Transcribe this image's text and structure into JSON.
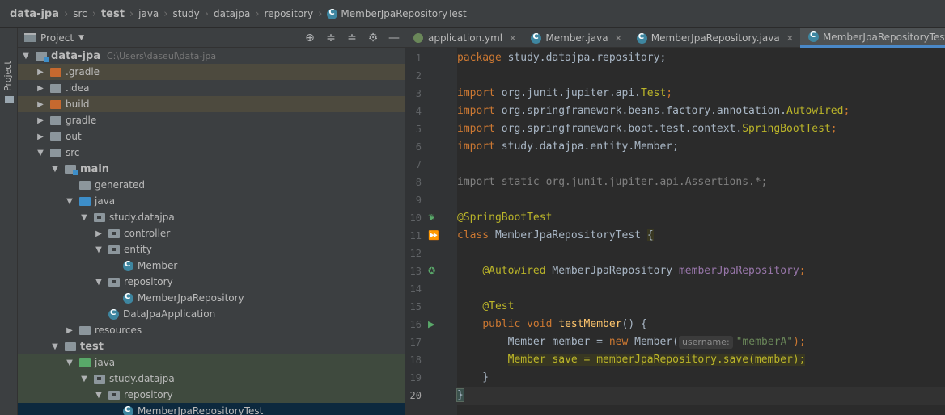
{
  "breadcrumb": [
    "data-jpa",
    "src",
    "test",
    "java",
    "study",
    "datajpa",
    "repository",
    "MemberJpaRepositoryTest"
  ],
  "strip": {
    "label": "Project"
  },
  "panel": {
    "title": "Project"
  },
  "tree": [
    {
      "label": "data-jpa",
      "path": "C:\\Users\\daseul\\data-jpa"
    },
    {
      "label": ".gradle"
    },
    {
      "label": ".idea"
    },
    {
      "label": "build"
    },
    {
      "label": "gradle"
    },
    {
      "label": "out"
    },
    {
      "label": "src"
    },
    {
      "label": "main"
    },
    {
      "label": "generated"
    },
    {
      "label": "java"
    },
    {
      "label": "study.datajpa"
    },
    {
      "label": "controller"
    },
    {
      "label": "entity"
    },
    {
      "label": "Member"
    },
    {
      "label": "repository"
    },
    {
      "label": "MemberJpaRepository"
    },
    {
      "label": "DataJpaApplication"
    },
    {
      "label": "resources"
    },
    {
      "label": "test"
    },
    {
      "label": "java"
    },
    {
      "label": "study.datajpa"
    },
    {
      "label": "repository"
    },
    {
      "label": "MemberJpaRepositoryTest"
    }
  ],
  "tabs": [
    "application.yml",
    "Member.java",
    "MemberJpaRepository.java",
    "MemberJpaRepositoryTest.java"
  ],
  "code": {
    "l1": [
      "package",
      " study.datajpa.repository;"
    ],
    "l3": [
      "import",
      " org.junit.jupiter.api.",
      "Test",
      ";"
    ],
    "l4": [
      "import",
      " org.springframework.beans.factory.annotation.",
      "Autowired",
      ";"
    ],
    "l5": [
      "import",
      " org.springframework.boot.test.context.",
      "SpringBootTest",
      ";"
    ],
    "l6": [
      "import",
      " study.datajpa.entity.Member;"
    ],
    "l8": "import static org.junit.jupiter.api.Assertions.*;",
    "l10": "@SpringBootTest",
    "l11": [
      "class",
      " MemberJpaRepositoryTest ",
      "{"
    ],
    "l13": [
      "    ",
      "@Autowired",
      " MemberJpaRepository ",
      "memberJpaRepository",
      ";"
    ],
    "l15": [
      "    ",
      "@Test"
    ],
    "l16": [
      "    ",
      "public",
      " ",
      "void",
      " ",
      "testMember",
      "() {"
    ],
    "l17": [
      "        Member member = ",
      "new",
      " Member(",
      "username:",
      "\"memberA\"",
      ");"
    ],
    "l18": [
      "        ",
      "Member save = memberJpaRepository.save(member);"
    ],
    "l19": "    }",
    "l20": "}",
    "line_numbers": [
      "1",
      "2",
      "3",
      "4",
      "5",
      "6",
      "7",
      "8",
      "9",
      "10",
      "11",
      "12",
      "13",
      "14",
      "15",
      "16",
      "17",
      "18",
      "19",
      "20"
    ]
  },
  "colors": {
    "keyword": "#cc7832",
    "annotation": "#bbb529",
    "field": "#9876aa",
    "method": "#ffc66d",
    "string": "#6a8759",
    "accent": "#4a88c7"
  }
}
